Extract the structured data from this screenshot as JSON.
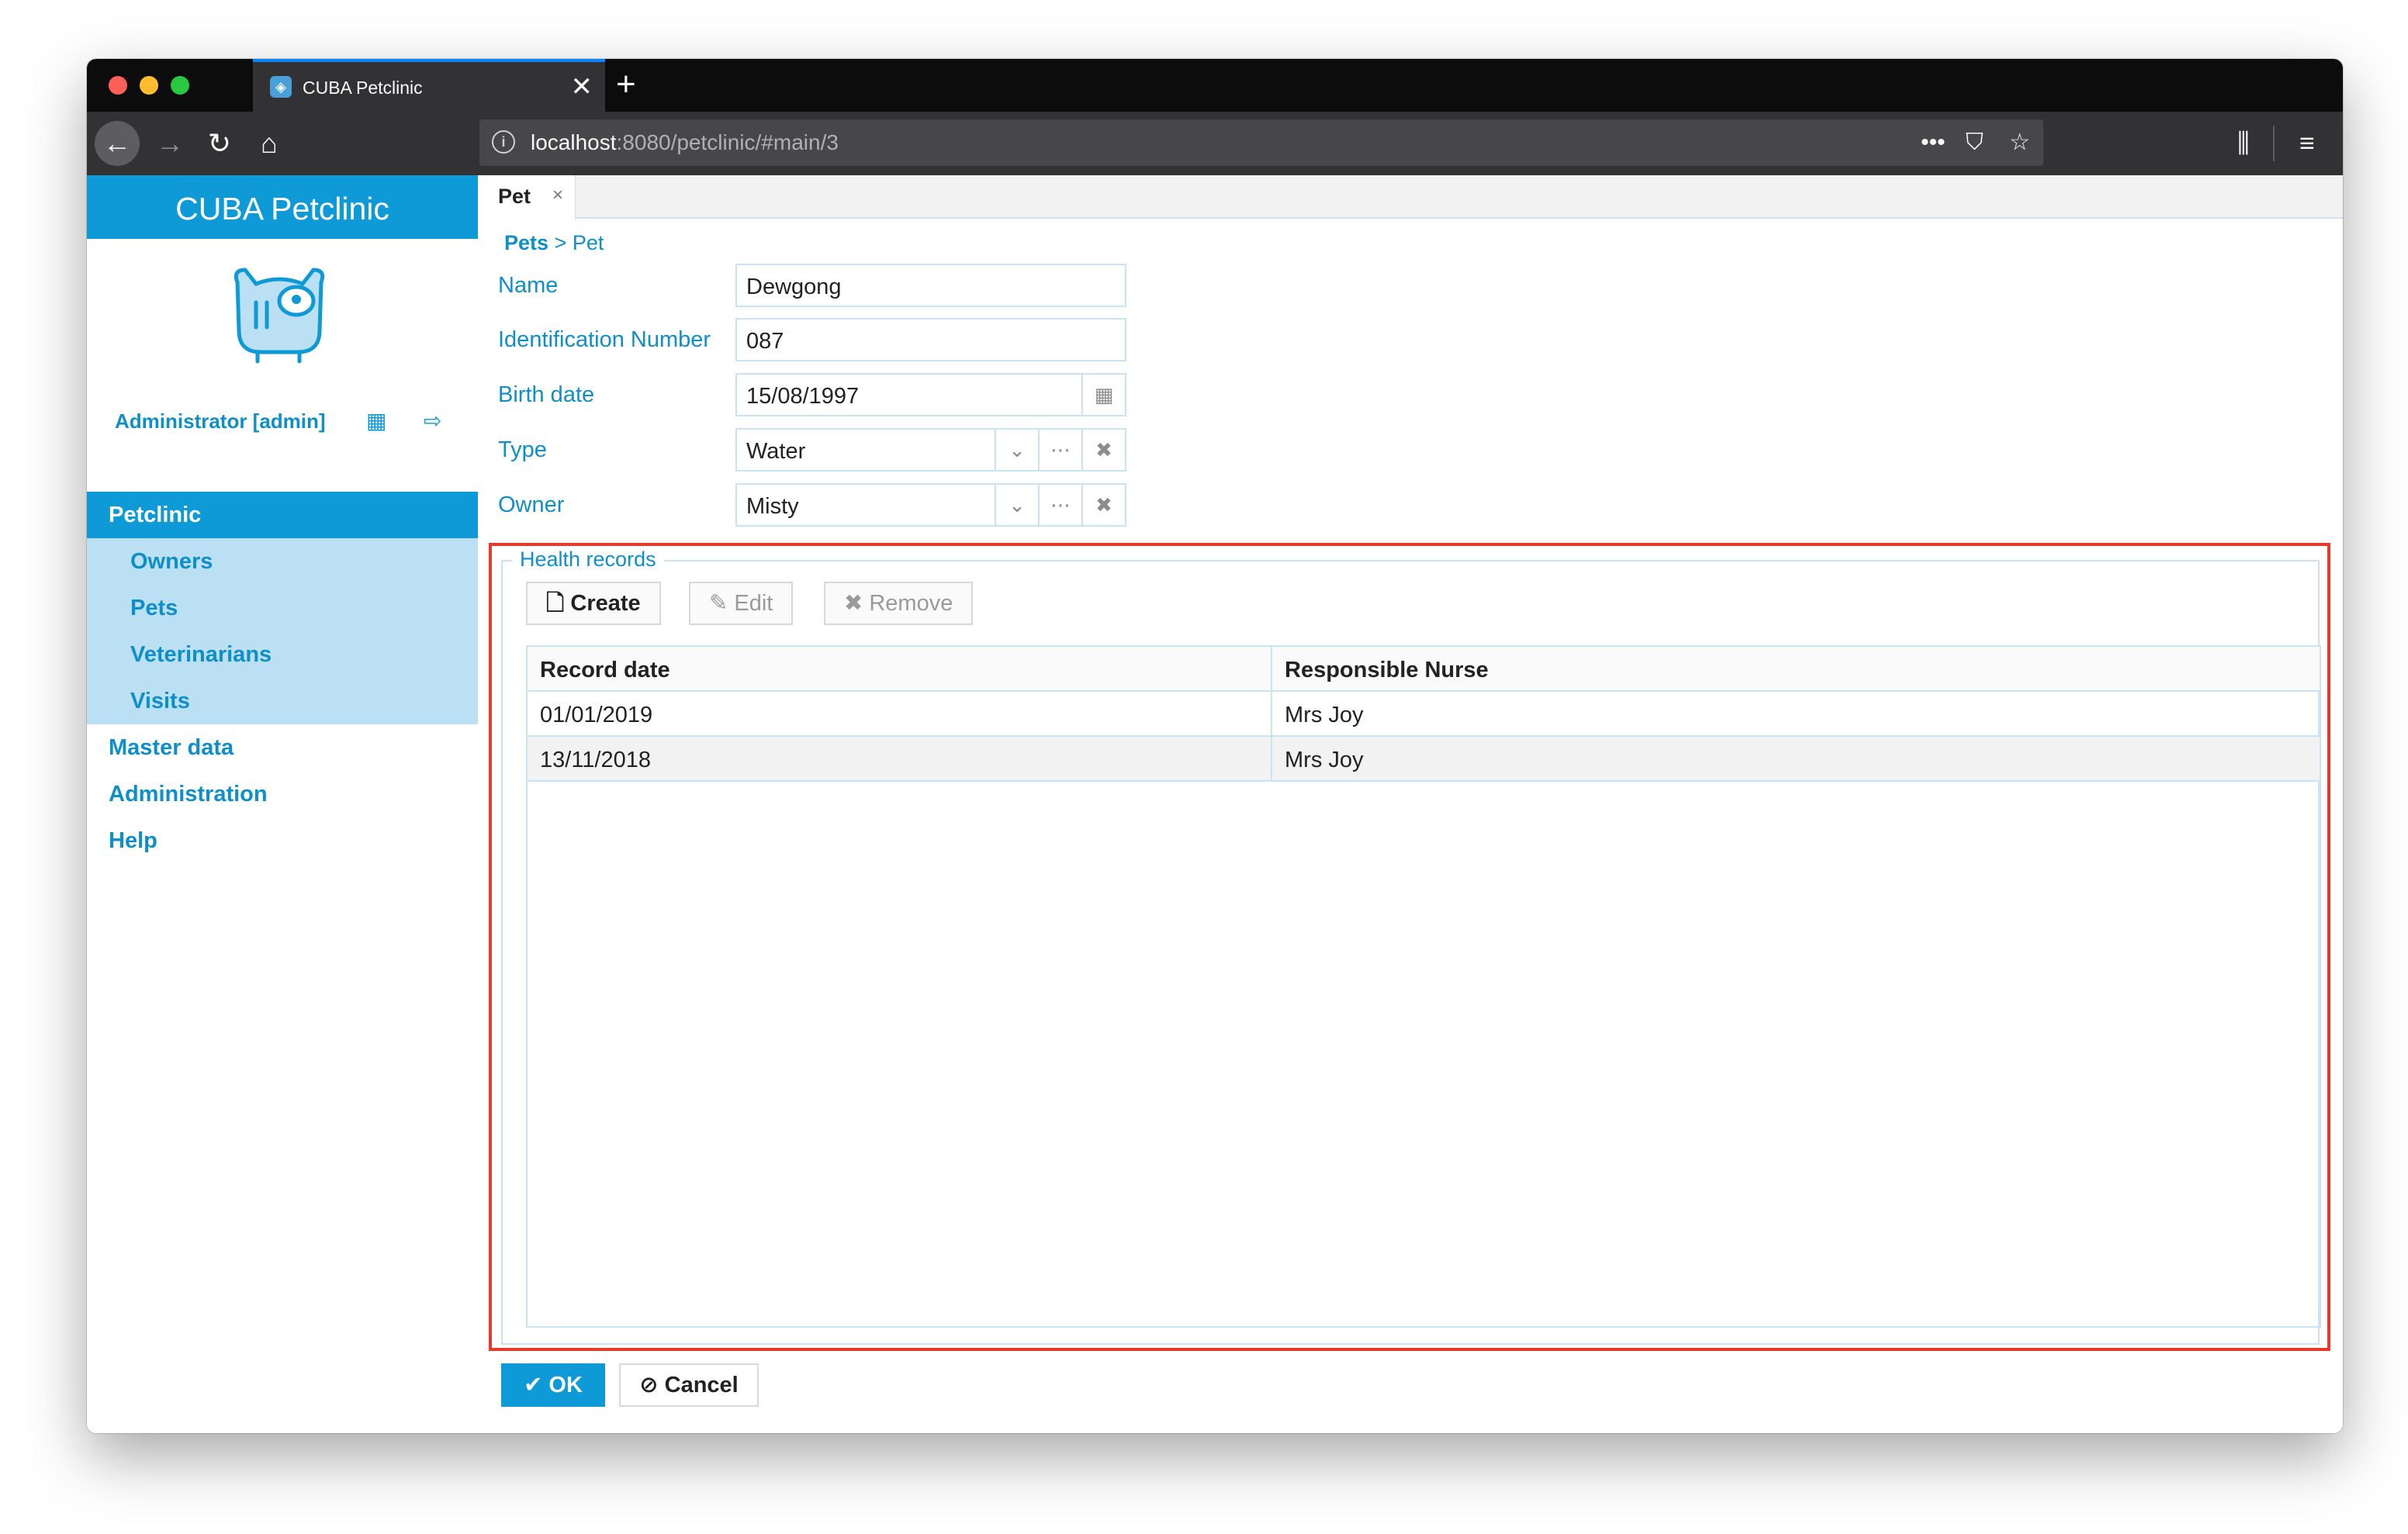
{
  "browser": {
    "tab_title": "CUBA Petclinic",
    "tab_close": "✕",
    "new_tab": "+",
    "url_host": "localhost",
    "url_rest": ":8080/petclinic/#main/3"
  },
  "sidebar": {
    "app_title": "CUBA Petclinic",
    "user_name": "Administrator [admin]",
    "menu": {
      "petclinic": "Petclinic",
      "owners": "Owners",
      "pets": "Pets",
      "veterinarians": "Veterinarians",
      "visits": "Visits",
      "master_data": "Master data",
      "administration": "Administration",
      "help": "Help"
    }
  },
  "workspace": {
    "tab_label": "Pet",
    "tab_close": "×"
  },
  "breadcrumb": {
    "parent": "Pets",
    "separator": ">",
    "current": "Pet"
  },
  "form": {
    "name": {
      "label": "Name",
      "value": "Dewgong"
    },
    "identification_number": {
      "label": "Identification Number",
      "value": "087"
    },
    "birth_date": {
      "label": "Birth date",
      "value": "15/08/1997"
    },
    "type": {
      "label": "Type",
      "value": "Water"
    },
    "owner": {
      "label": "Owner",
      "value": "Misty"
    }
  },
  "health_records": {
    "caption": "Health records",
    "buttons": {
      "create": "Create",
      "edit": "Edit",
      "remove": "Remove"
    },
    "columns": [
      "Record date",
      "Responsible Nurse"
    ],
    "rows": [
      {
        "record_date": "01/01/2019",
        "responsible_nurse": "Mrs Joy"
      },
      {
        "record_date": "13/11/2018",
        "responsible_nurse": "Mrs Joy"
      }
    ]
  },
  "footer": {
    "ok": "OK",
    "cancel": "Cancel"
  },
  "colors": {
    "accent": "#0e9ad6",
    "highlight": "#e53a2e"
  }
}
